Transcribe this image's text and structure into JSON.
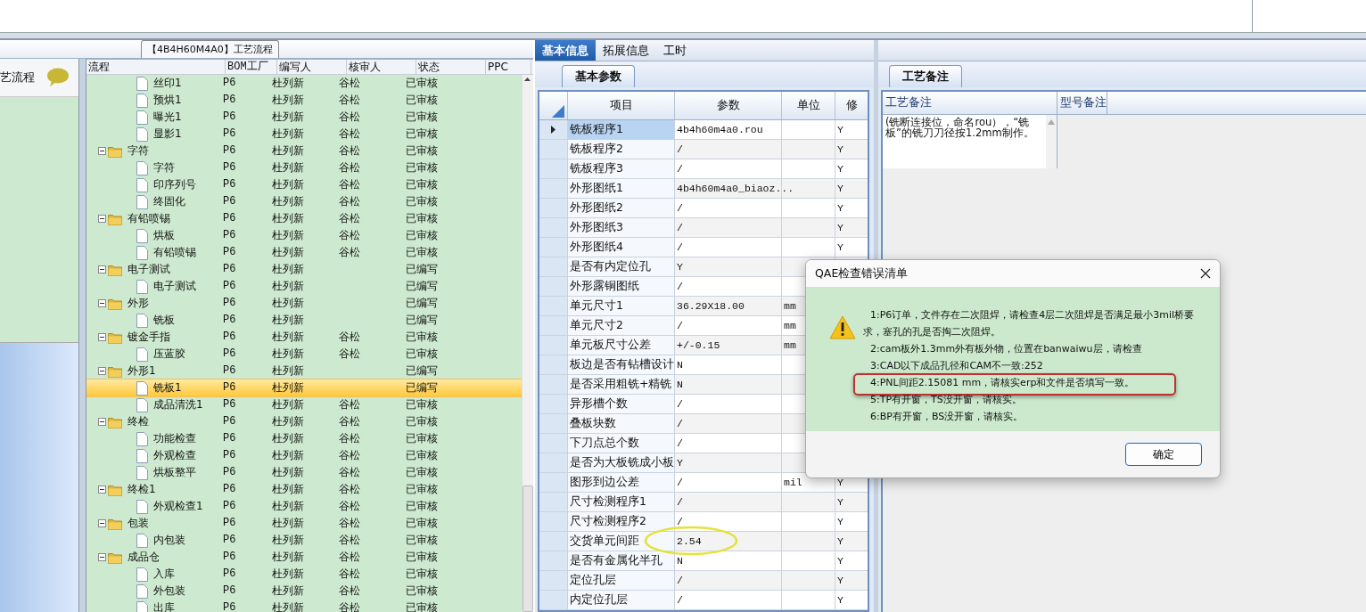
{
  "tree_panel": {
    "title": "【4B4H60M4A0】工艺流程",
    "side_header": "艺流程",
    "columns": [
      "流程",
      "BOM工厂",
      "编写人",
      "核审人",
      "状态",
      "PPC"
    ],
    "partial_group_children": [
      {
        "name": "丝印1",
        "bom_factory": "P6",
        "writer": "杜列新",
        "reviewer": "谷松",
        "status": "已审核",
        "selected": false
      },
      {
        "name": "预烘1",
        "bom_factory": "P6",
        "writer": "杜列新",
        "reviewer": "谷松",
        "status": "已审核",
        "selected": false
      },
      {
        "name": "曝光1",
        "bom_factory": "P6",
        "writer": "杜列新",
        "reviewer": "谷松",
        "status": "已审核",
        "selected": false
      },
      {
        "name": "显影1",
        "bom_factory": "P6",
        "writer": "杜列新",
        "reviewer": "谷松",
        "status": "已审核",
        "selected": false
      }
    ],
    "groups": [
      {
        "name": "字符",
        "bom_factory": "P6",
        "writer": "杜列新",
        "reviewer": "谷松",
        "status": "已审核",
        "selected": false,
        "expanded": true,
        "children": [
          {
            "name": "字符",
            "bom_factory": "P6",
            "writer": "杜列新",
            "reviewer": "谷松",
            "status": "已审核",
            "selected": false
          },
          {
            "name": "印序列号",
            "bom_factory": "P6",
            "writer": "杜列新",
            "reviewer": "谷松",
            "status": "已审核",
            "selected": false
          },
          {
            "name": "终固化",
            "bom_factory": "P6",
            "writer": "杜列新",
            "reviewer": "谷松",
            "status": "已审核",
            "selected": false
          }
        ]
      },
      {
        "name": "有铅喷锡",
        "bom_factory": "P6",
        "writer": "杜列新",
        "reviewer": "谷松",
        "status": "已审核",
        "selected": false,
        "expanded": true,
        "children": [
          {
            "name": "烘板",
            "bom_factory": "P6",
            "writer": "杜列新",
            "reviewer": "谷松",
            "status": "已审核",
            "selected": false
          },
          {
            "name": "有铅喷锡",
            "bom_factory": "P6",
            "writer": "杜列新",
            "reviewer": "谷松",
            "status": "已审核",
            "selected": false
          }
        ]
      },
      {
        "name": "电子测试",
        "bom_factory": "P6",
        "writer": "杜列新",
        "status": "已编写",
        "selected": false,
        "expanded": true,
        "children": [
          {
            "name": "电子测试",
            "bom_factory": "P6",
            "writer": "杜列新",
            "status": "已编写",
            "selected": false
          }
        ]
      },
      {
        "name": "外形",
        "bom_factory": "P6",
        "writer": "杜列新",
        "status": "已编写",
        "selected": false,
        "expanded": true,
        "children": [
          {
            "name": "铣板",
            "bom_factory": "P6",
            "writer": "杜列新",
            "status": "已编写",
            "selected": false
          }
        ]
      },
      {
        "name": "镀金手指",
        "bom_factory": "P6",
        "writer": "杜列新",
        "reviewer": "谷松",
        "status": "已审核",
        "selected": false,
        "expanded": true,
        "children": [
          {
            "name": "压蓝胶",
            "bom_factory": "P6",
            "writer": "杜列新",
            "reviewer": "谷松",
            "status": "已审核",
            "selected": false
          }
        ]
      },
      {
        "name": "外形1",
        "bom_factory": "P6",
        "writer": "杜列新",
        "status": "已编写",
        "selected": false,
        "expanded": true,
        "children": [
          {
            "name": "铣板1",
            "bom_factory": "P6",
            "writer": "杜列新",
            "status": "已编写",
            "selected": true
          },
          {
            "name": "成品清洗1",
            "bom_factory": "P6",
            "writer": "杜列新",
            "reviewer": "谷松",
            "status": "已审核",
            "selected": false
          }
        ]
      },
      {
        "name": "终检",
        "bom_factory": "P6",
        "writer": "杜列新",
        "reviewer": "谷松",
        "status": "已审核",
        "selected": false,
        "expanded": true,
        "children": [
          {
            "name": "功能检查",
            "bom_factory": "P6",
            "writer": "杜列新",
            "reviewer": "谷松",
            "status": "已审核",
            "selected": false
          },
          {
            "name": "外观检查",
            "bom_factory": "P6",
            "writer": "杜列新",
            "reviewer": "谷松",
            "status": "已审核",
            "selected": false
          },
          {
            "name": "烘板整平",
            "bom_factory": "P6",
            "writer": "杜列新",
            "reviewer": "谷松",
            "status": "已审核",
            "selected": false
          }
        ]
      },
      {
        "name": "终检1",
        "bom_factory": "P6",
        "writer": "杜列新",
        "reviewer": "谷松",
        "status": "已审核",
        "selected": false,
        "expanded": true,
        "children": [
          {
            "name": "外观检查1",
            "bom_factory": "P6",
            "writer": "杜列新",
            "reviewer": "谷松",
            "status": "已审核",
            "selected": false
          }
        ]
      },
      {
        "name": "包装",
        "bom_factory": "P6",
        "writer": "杜列新",
        "reviewer": "谷松",
        "status": "已审核",
        "selected": false,
        "expanded": true,
        "children": [
          {
            "name": "内包装",
            "bom_factory": "P6",
            "writer": "杜列新",
            "reviewer": "谷松",
            "status": "已审核",
            "selected": false
          }
        ]
      },
      {
        "name": "成品仓",
        "bom_factory": "P6",
        "writer": "杜列新",
        "reviewer": "谷松",
        "status": "已审核",
        "selected": false,
        "expanded": true,
        "children": [
          {
            "name": "入库",
            "bom_factory": "P6",
            "writer": "杜列新",
            "reviewer": "谷松",
            "status": "已审核",
            "selected": false
          },
          {
            "name": "外包装",
            "bom_factory": "P6",
            "writer": "杜列新",
            "reviewer": "谷松",
            "status": "已审核",
            "selected": false
          },
          {
            "name": "出库",
            "bom_factory": "P6",
            "writer": "杜列新",
            "reviewer": "谷松",
            "status": "已审核",
            "selected": false
          }
        ]
      }
    ]
  },
  "info_panel": {
    "tabs": [
      {
        "label": "基本信息",
        "selected": true
      },
      {
        "label": "拓展信息",
        "selected": false
      },
      {
        "label": "工时",
        "selected": false
      }
    ],
    "sub_tab": "基本参数",
    "columns": [
      "项目",
      "参数",
      "单位",
      "修"
    ],
    "rows": [
      {
        "item": "铣板程序1",
        "param": "4b4h60m4a0.rou",
        "modified": "Y",
        "selected": true
      },
      {
        "item": "铣板程序2",
        "param": "/",
        "modified": "Y",
        "selected": false
      },
      {
        "item": "铣板程序3",
        "param": "/",
        "modified": "Y",
        "selected": false
      },
      {
        "item": "外形图纸1",
        "param": "4b4h60m4a0_biaoz...",
        "modified": "Y",
        "selected": false
      },
      {
        "item": "外形图纸2",
        "param": "/",
        "modified": "Y",
        "selected": false
      },
      {
        "item": "外形图纸3",
        "param": "/",
        "modified": "Y",
        "selected": false
      },
      {
        "item": "外形图纸4",
        "param": "/",
        "modified": "Y",
        "selected": false
      },
      {
        "item": "是否有内定位孔",
        "param": "Y",
        "selected": false
      },
      {
        "item": "外形露铜图纸",
        "param": "/",
        "selected": false
      },
      {
        "item": "单元尺寸1",
        "param": "36.29X18.00",
        "unit": "mm",
        "selected": false
      },
      {
        "item": "单元尺寸2",
        "param": "/",
        "unit": "mm",
        "selected": false
      },
      {
        "item": "单元板尺寸公差",
        "param": "+/-0.15",
        "unit": "mm",
        "selected": false
      },
      {
        "item": "板边是否有钻槽设计",
        "param": "N",
        "selected": false
      },
      {
        "item": "是否采用粗铣+精铣",
        "param": "N",
        "selected": false
      },
      {
        "item": "异形槽个数",
        "param": "/",
        "selected": false
      },
      {
        "item": "叠板块数",
        "param": "/",
        "selected": false
      },
      {
        "item": "下刀点总个数",
        "param": "/",
        "selected": false
      },
      {
        "item": "是否为大板铣成小板",
        "param": "Y",
        "selected": false
      },
      {
        "item": "图形到边公差",
        "param": "/",
        "unit": "mil",
        "modified": "Y",
        "selected": false
      },
      {
        "item": "尺寸检测程序1",
        "param": "/",
        "modified": "Y",
        "selected": false
      },
      {
        "item": "尺寸检测程序2",
        "param": "/",
        "modified": "Y",
        "selected": false
      },
      {
        "item": "交货单元间距",
        "param": "2.54",
        "modified": "Y",
        "selected": false,
        "circled": true
      },
      {
        "item": "是否有金属化半孔",
        "param": "N",
        "modified": "Y",
        "selected": false
      },
      {
        "item": "定位孔层",
        "param": "/",
        "modified": "Y",
        "selected": false
      },
      {
        "item": "内定位孔层",
        "param": "/",
        "modified": "Y",
        "selected": false
      }
    ]
  },
  "notes_panel": {
    "tab": "工艺备注",
    "columns": [
      "工艺备注",
      "型号备注"
    ],
    "process_note_lines": [
      "(铣断连接位，命名rou），“铣",
      "板”的铣刀刀径按1.2mm制作。"
    ]
  },
  "dialog": {
    "title": "QAE检查错误清单",
    "messages": [
      {
        "text": "1:P6订单，文件存在二次阻焊，请检查4层二次阻焊是否满足最小3mil桥要求，塞孔的孔是否掏二次阻焊。",
        "boxed": false
      },
      {
        "text": "2:cam板外1.3mm外有板外物，位置在banwaiwu层，请检查",
        "boxed": false
      },
      {
        "text": "3:CAD以下成品孔径和CAM不一致:252",
        "boxed": false
      },
      {
        "text": "4:PNL间距2.15081 mm，请核实erp和文件是否填写一致。",
        "boxed": true
      },
      {
        "text": "5:TP有开窗，TS没开窗，请核实。",
        "boxed": false
      },
      {
        "text": "6:BP有开窗，BS没开窗，请核实。",
        "boxed": false
      }
    ],
    "button": "确定"
  }
}
